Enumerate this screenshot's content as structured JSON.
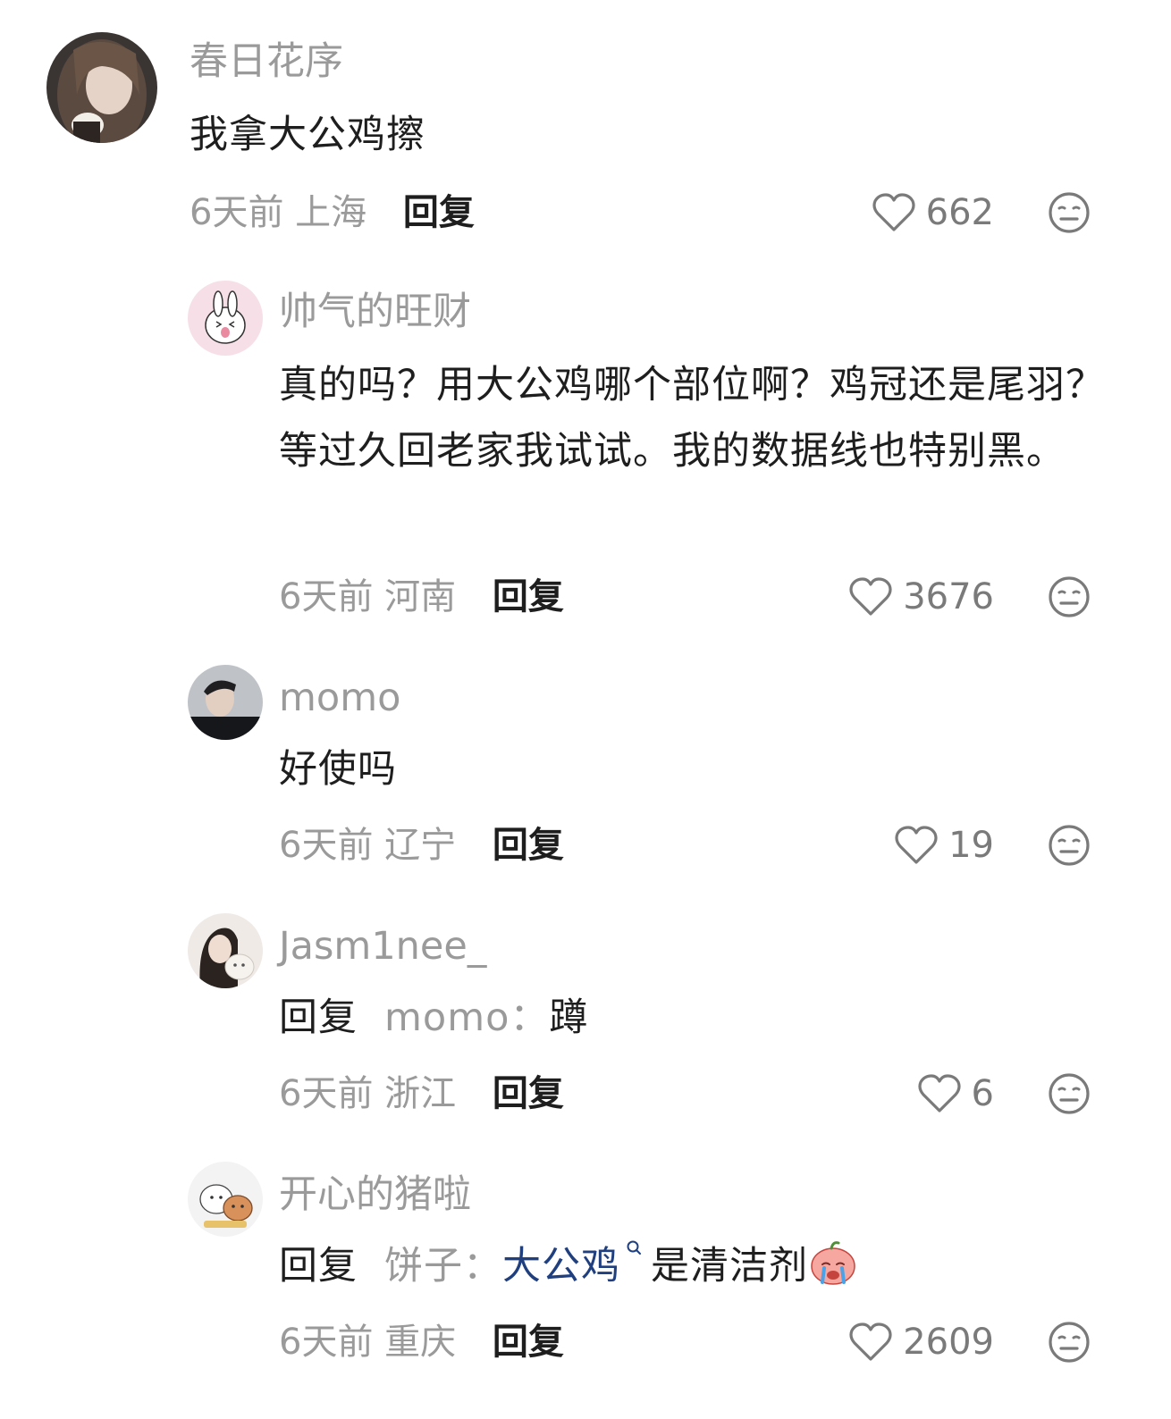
{
  "comments": [
    {
      "username": "春日花序",
      "text": "我拿大公鸡擦",
      "time": "6天前",
      "location": "上海",
      "reply_label": "回复",
      "likes": "662"
    },
    {
      "username": "帅气的旺财",
      "text": "真的吗？用大公鸡哪个部位啊？鸡冠还是尾羽？等过久回老家我试试。我的数据线也特别黑。",
      "time": "6天前",
      "location": "河南",
      "reply_label": "回复",
      "likes": "3676"
    },
    {
      "username": "momo",
      "text": "好使吗",
      "time": "6天前",
      "location": "辽宁",
      "reply_label": "回复",
      "likes": "19"
    },
    {
      "username": "Jasm1nee_",
      "reply_prefix": "回复",
      "reply_to": "momo：",
      "text": "蹲",
      "time": "6天前",
      "location": "浙江",
      "reply_label": "回复",
      "likes": "6"
    },
    {
      "username": "开心的猪啦",
      "reply_prefix": "回复",
      "reply_to": "饼子：",
      "link_text": "大公鸡",
      "text": "是清洁剂",
      "time": "6天前",
      "location": "重庆",
      "reply_label": "回复",
      "likes": "2609"
    }
  ],
  "colors": {
    "muted": "#9a9a9a",
    "text": "#1e1e1e",
    "link": "#1f3f7f",
    "icon": "#7a7a7a"
  },
  "icons": {
    "like": "heart-outline-icon",
    "dislike": "neutral-face-icon",
    "search": "search-icon",
    "emoji": "crying-emoji-icon"
  }
}
